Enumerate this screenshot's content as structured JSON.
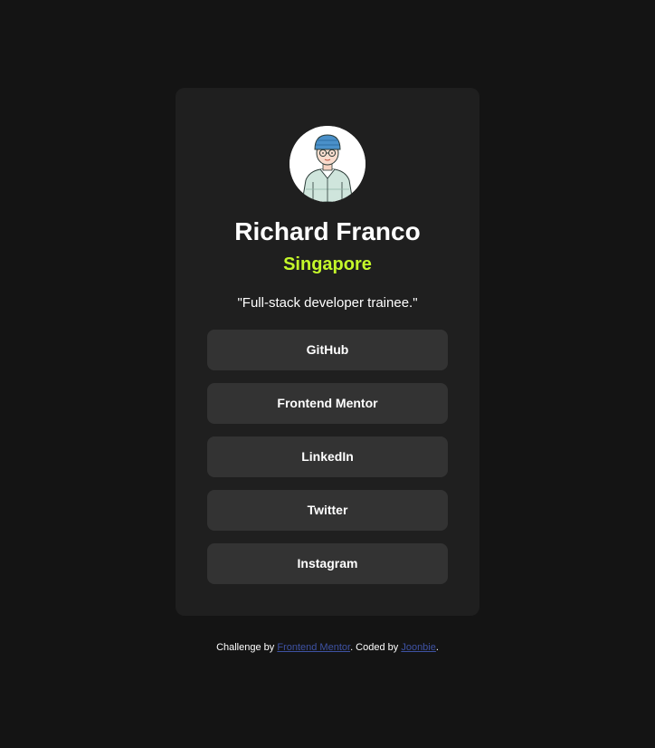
{
  "profile": {
    "name": "Richard Franco",
    "location": "Singapore",
    "bio": "\"Full-stack developer trainee.\""
  },
  "links": [
    {
      "label": "GitHub"
    },
    {
      "label": "Frontend Mentor"
    },
    {
      "label": "LinkedIn"
    },
    {
      "label": "Twitter"
    },
    {
      "label": "Instagram"
    }
  ],
  "footer": {
    "prefix": "Challenge by ",
    "challenge_link": "Frontend Mentor",
    "middle": ". Coded by ",
    "author_link": "Joonbie",
    "suffix": "."
  },
  "colors": {
    "background": "#141414",
    "card": "#1f1f1f",
    "button": "#333333",
    "accent": "#c4f82a",
    "link": "#3e52a3"
  }
}
